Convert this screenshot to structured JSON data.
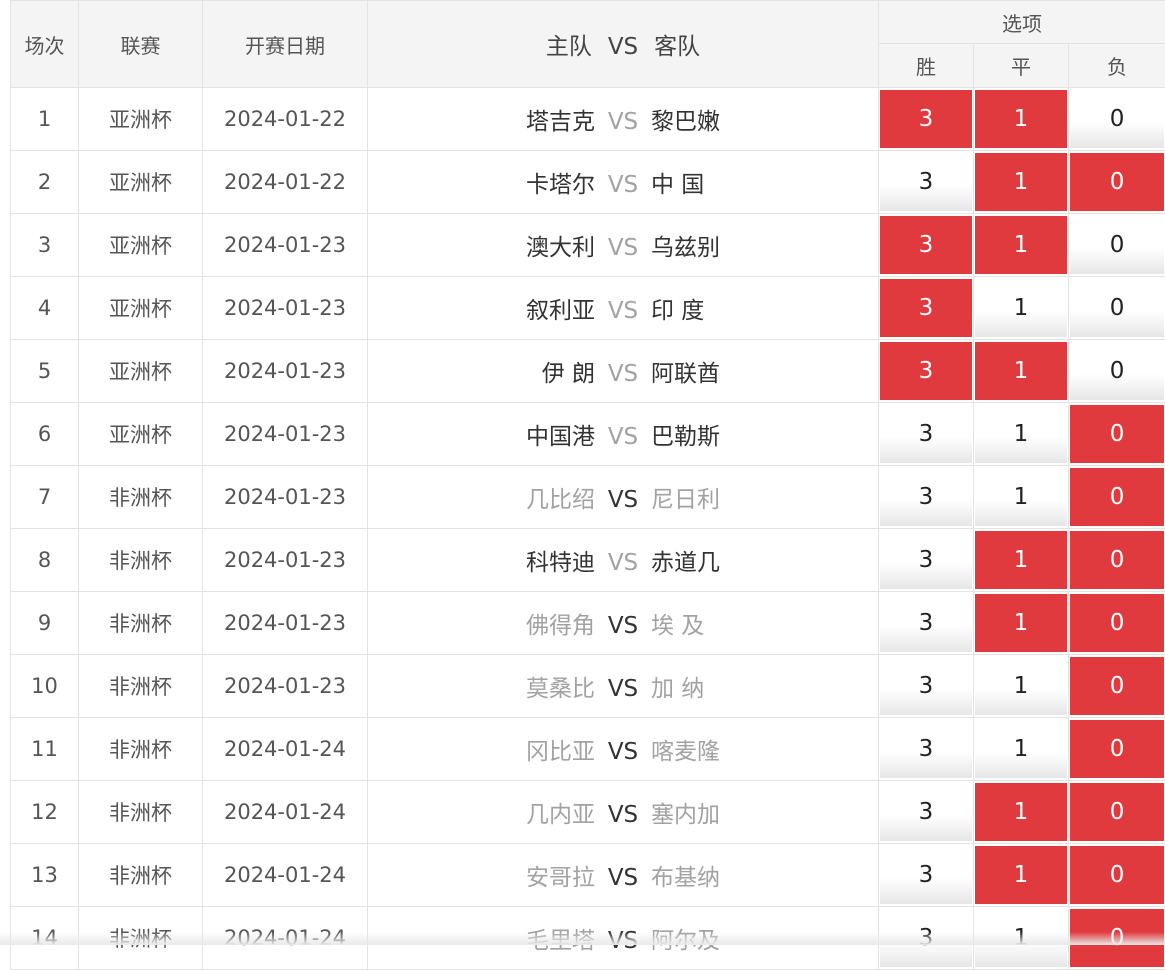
{
  "headers": {
    "index": "场次",
    "league": "联赛",
    "date": "开赛日期",
    "home": "主队",
    "vs": "VS",
    "away": "客队",
    "options": "选项",
    "win": "胜",
    "draw": "平",
    "lose": "负"
  },
  "colors": {
    "selected": "#e03a3e",
    "header_bg": "#f4f4f4",
    "muted_text": "#a2a2a2"
  },
  "rows": [
    {
      "index": "1",
      "league": "亚洲杯",
      "date": "2024-01-22",
      "home": "塔吉克",
      "vs": "VS",
      "away": "黎巴嫩",
      "muted": "vs",
      "win": "3",
      "draw": "1",
      "lose": "0",
      "sel": [
        true,
        true,
        false
      ]
    },
    {
      "index": "2",
      "league": "亚洲杯",
      "date": "2024-01-22",
      "home": "卡塔尔",
      "vs": "VS",
      "away": "中 国",
      "muted": "vs",
      "win": "3",
      "draw": "1",
      "lose": "0",
      "sel": [
        false,
        true,
        true
      ]
    },
    {
      "index": "3",
      "league": "亚洲杯",
      "date": "2024-01-23",
      "home": "澳大利",
      "vs": "VS",
      "away": "乌兹别",
      "muted": "vs",
      "win": "3",
      "draw": "1",
      "lose": "0",
      "sel": [
        true,
        true,
        false
      ]
    },
    {
      "index": "4",
      "league": "亚洲杯",
      "date": "2024-01-23",
      "home": "叙利亚",
      "vs": "VS",
      "away": "印 度",
      "muted": "vs",
      "win": "3",
      "draw": "1",
      "lose": "0",
      "sel": [
        true,
        false,
        false
      ]
    },
    {
      "index": "5",
      "league": "亚洲杯",
      "date": "2024-01-23",
      "home": "伊 朗",
      "vs": "VS",
      "away": "阿联酋",
      "muted": "vs",
      "win": "3",
      "draw": "1",
      "lose": "0",
      "sel": [
        true,
        true,
        false
      ]
    },
    {
      "index": "6",
      "league": "亚洲杯",
      "date": "2024-01-23",
      "home": "中国港",
      "vs": "VS",
      "away": "巴勒斯",
      "muted": "vs",
      "win": "3",
      "draw": "1",
      "lose": "0",
      "sel": [
        false,
        false,
        true
      ]
    },
    {
      "index": "7",
      "league": "非洲杯",
      "date": "2024-01-23",
      "home": "几比绍",
      "vs": "VS",
      "away": "尼日利",
      "muted": "teams",
      "win": "3",
      "draw": "1",
      "lose": "0",
      "sel": [
        false,
        false,
        true
      ]
    },
    {
      "index": "8",
      "league": "非洲杯",
      "date": "2024-01-23",
      "home": "科特迪",
      "vs": "VS",
      "away": "赤道几",
      "muted": "vs",
      "win": "3",
      "draw": "1",
      "lose": "0",
      "sel": [
        false,
        true,
        true
      ]
    },
    {
      "index": "9",
      "league": "非洲杯",
      "date": "2024-01-23",
      "home": "佛得角",
      "vs": "VS",
      "away": "埃 及",
      "muted": "teams",
      "win": "3",
      "draw": "1",
      "lose": "0",
      "sel": [
        false,
        true,
        true
      ]
    },
    {
      "index": "10",
      "league": "非洲杯",
      "date": "2024-01-23",
      "home": "莫桑比",
      "vs": "VS",
      "away": "加 纳",
      "muted": "teams",
      "win": "3",
      "draw": "1",
      "lose": "0",
      "sel": [
        false,
        false,
        true
      ]
    },
    {
      "index": "11",
      "league": "非洲杯",
      "date": "2024-01-24",
      "home": "冈比亚",
      "vs": "VS",
      "away": "喀麦隆",
      "muted": "teams",
      "win": "3",
      "draw": "1",
      "lose": "0",
      "sel": [
        false,
        false,
        true
      ]
    },
    {
      "index": "12",
      "league": "非洲杯",
      "date": "2024-01-24",
      "home": "几内亚",
      "vs": "VS",
      "away": "塞内加",
      "muted": "teams",
      "win": "3",
      "draw": "1",
      "lose": "0",
      "sel": [
        false,
        true,
        true
      ]
    },
    {
      "index": "13",
      "league": "非洲杯",
      "date": "2024-01-24",
      "home": "安哥拉",
      "vs": "VS",
      "away": "布基纳",
      "muted": "teams",
      "win": "3",
      "draw": "1",
      "lose": "0",
      "sel": [
        false,
        true,
        true
      ]
    },
    {
      "index": "14",
      "league": "非洲杯",
      "date": "2024-01-24",
      "home": "毛里塔",
      "vs": "VS",
      "away": "阿尔及",
      "muted": "teams",
      "win": "3",
      "draw": "1",
      "lose": "0",
      "sel": [
        false,
        false,
        true
      ]
    }
  ]
}
